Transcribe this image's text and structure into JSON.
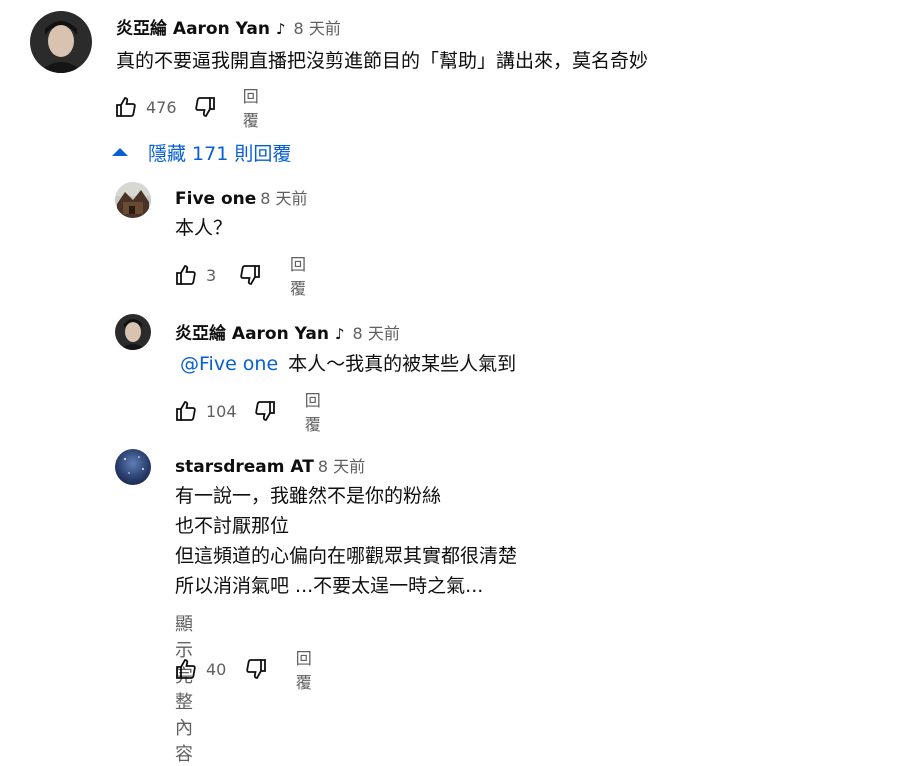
{
  "top_comment": {
    "author": "炎亞綸 Aaron Yan",
    "time": "8 天前",
    "text": "真的不要逼我開直播把沒剪進節目的「幫助」講出來，莫名奇妙",
    "likes": "476",
    "reply_label": "回覆"
  },
  "replies_toggle": {
    "label": "隱藏 171 則回覆"
  },
  "replies": [
    {
      "author": "Five one",
      "time": "8 天前",
      "text": "本人？",
      "likes": "3",
      "reply_label": "回覆"
    },
    {
      "author": "炎亞綸 Aaron Yan",
      "time": "8 天前",
      "mention": "@Five one",
      "text": "本人～我真的被某些人氣到",
      "likes": "104",
      "reply_label": "回覆"
    },
    {
      "author": "starsdream AT",
      "time": "8 天前",
      "lines": [
        "有一說一，我雖然不是你的粉絲",
        "也不討厭那位",
        "但這頻道的心偏向在哪觀眾其實都很清楚",
        "所以消消氣吧 ...不要太逞一時之氣..."
      ],
      "show_more": "顯示完整內容",
      "likes": "40",
      "reply_label": "回覆"
    }
  ],
  "icons": {
    "like": "thumbs-up-icon",
    "dislike": "thumbs-down-icon",
    "music": "music-note-icon",
    "collapse": "caret-up-icon"
  },
  "colors": {
    "link": "#065fd4",
    "secondary_text": "#606060"
  }
}
